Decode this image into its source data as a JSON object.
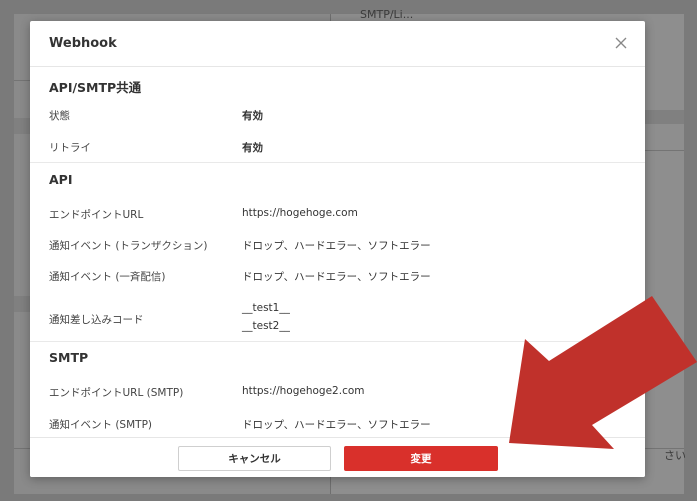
{
  "background": {
    "top_right_snippet": "SMTP/Li...",
    "right_edge_snippet": "さい"
  },
  "modal": {
    "title": "Webhook",
    "close_label": "close",
    "sections": [
      {
        "title": "API/SMTP共通",
        "rows": [
          {
            "label": "状態",
            "value": "有効"
          },
          {
            "label": "リトライ",
            "value": "有効"
          }
        ]
      },
      {
        "title": "API",
        "rows": [
          {
            "label": "エンドポイントURL",
            "value": "https://hogehoge.com"
          },
          {
            "label": "通知イベント (トランザクション)",
            "value": "ドロップ、ハードエラー、ソフトエラー"
          },
          {
            "label": "通知イベント (一斉配信)",
            "value": "ドロップ、ハードエラー、ソフトエラー"
          },
          {
            "label": "通知差し込みコード",
            "value": "__test1__",
            "value2": "__test2__"
          }
        ]
      },
      {
        "title": "SMTP",
        "rows": [
          {
            "label": "エンドポイントURL (SMTP)",
            "value": "https://hogehoge2.com"
          },
          {
            "label": "通知イベント (SMTP)",
            "value": "ドロップ、ハードエラー、ソフトエラー"
          }
        ]
      }
    ],
    "footer": {
      "cancel_label": "キャンセル",
      "change_label": "変更"
    }
  },
  "colors": {
    "accent": "#d9302b",
    "arrow": "#c0312b"
  }
}
